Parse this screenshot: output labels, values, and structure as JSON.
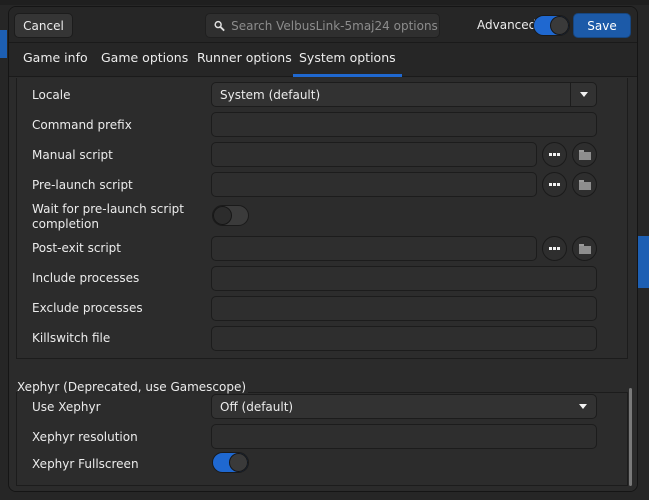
{
  "header": {
    "cancel_label": "Cancel",
    "search_placeholder": "Search VelbusLink-5maj24 options",
    "search_value": "",
    "advanced_label": "Advanced",
    "advanced_enabled": true,
    "save_label": "Save"
  },
  "tabs": [
    {
      "label": "Game info",
      "active": false
    },
    {
      "label": "Game options",
      "active": false
    },
    {
      "label": "Runner options",
      "active": false
    },
    {
      "label": "System options",
      "active": true
    }
  ],
  "system_options": {
    "locale": {
      "label": "Locale",
      "value": "System (default)"
    },
    "command_prefix": {
      "label": "Command prefix",
      "value": ""
    },
    "manual_script": {
      "label": "Manual script",
      "value": ""
    },
    "pre_launch_script": {
      "label": "Pre-launch script",
      "value": ""
    },
    "wait_pre_launch": {
      "label": "Wait for pre-launch script completion",
      "label_line1": "Wait for pre-launch script",
      "label_line2": "completion",
      "enabled": false
    },
    "post_exit_script": {
      "label": "Post-exit script",
      "value": ""
    },
    "include_processes": {
      "label": "Include processes",
      "value": ""
    },
    "exclude_processes": {
      "label": "Exclude processes",
      "value": ""
    },
    "killswitch_file": {
      "label": "Killswitch file",
      "value": ""
    }
  },
  "xephyr": {
    "section_title": "Xephyr (Deprecated, use Gamescope)",
    "use_xephyr": {
      "label": "Use Xephyr",
      "value": "Off (default)"
    },
    "resolution": {
      "label": "Xephyr resolution",
      "value": ""
    },
    "fullscreen": {
      "label": "Xephyr Fullscreen",
      "enabled": true
    }
  },
  "icons": {
    "search": "search-icon",
    "more": "ellipsis-icon",
    "folder": "folder-icon",
    "dropdown": "chevron-down-icon"
  },
  "colors": {
    "accent": "#1f68d0",
    "save_button": "#1c5aa8",
    "background": "#2b2b2b"
  }
}
